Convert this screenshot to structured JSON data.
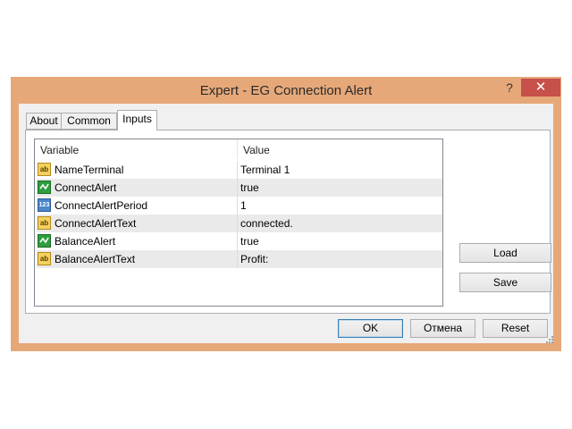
{
  "window": {
    "title": "Expert - EG Connection Alert",
    "help_glyph": "?",
    "close_glyph": "✕",
    "frame_color": "#e7a879",
    "close_color": "#c7504a"
  },
  "tabs": [
    {
      "label": "About",
      "active": false
    },
    {
      "label": "Common",
      "active": false
    },
    {
      "label": "Inputs",
      "active": true
    }
  ],
  "grid": {
    "columns": [
      "Variable",
      "Value"
    ],
    "rows": [
      {
        "icon": "string-icon",
        "icon_text": "ab",
        "name": "NameTerminal",
        "value": "Terminal 1"
      },
      {
        "icon": "bool-icon",
        "icon_text": "",
        "name": "ConnectAlert",
        "value": "true"
      },
      {
        "icon": "int-icon",
        "icon_text": "123",
        "name": "ConnectAlertPeriod",
        "value": "1"
      },
      {
        "icon": "string-icon",
        "icon_text": "ab",
        "name": "ConnectAlertText",
        "value": "connected."
      },
      {
        "icon": "bool-icon",
        "icon_text": "",
        "name": "BalanceAlert",
        "value": "true"
      },
      {
        "icon": "string-icon",
        "icon_text": "ab",
        "name": "BalanceAlertText",
        "value": "Profit:"
      }
    ]
  },
  "side_buttons": {
    "load": "Load",
    "save": "Save"
  },
  "footer": {
    "ok": "OK",
    "cancel": "Отмена",
    "reset": "Reset"
  }
}
